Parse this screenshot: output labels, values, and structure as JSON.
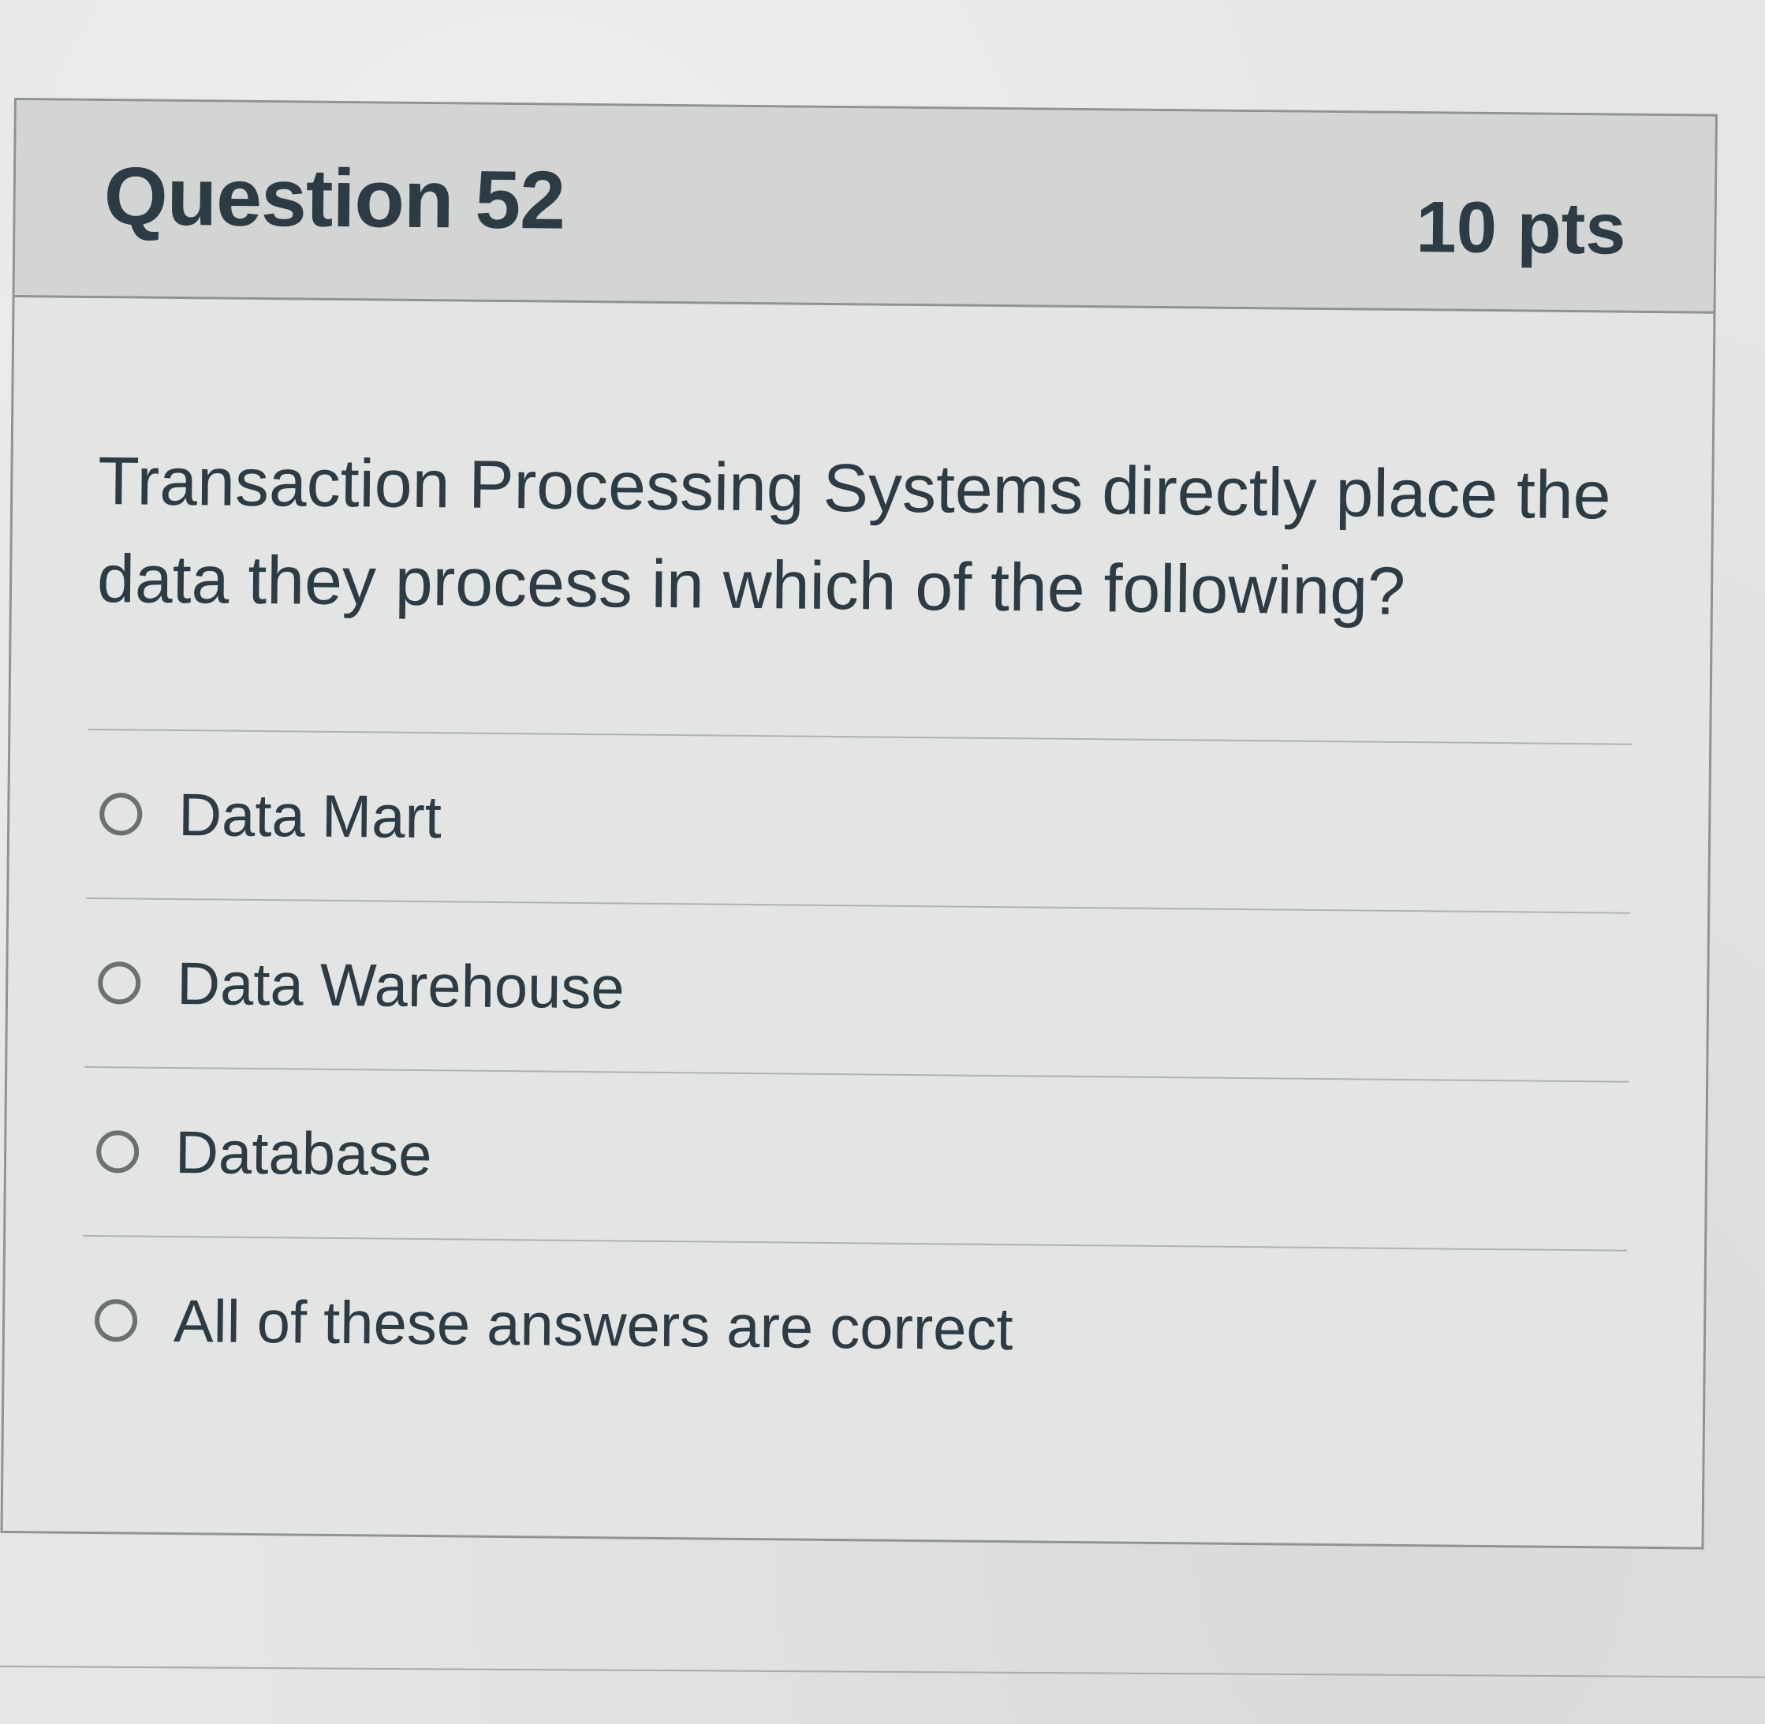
{
  "question": {
    "title": "Question 52",
    "points": "10 pts",
    "text": "Transaction Processing Systems directly place the data they process in which of the following?"
  },
  "answers": [
    {
      "label": "Data Mart",
      "selected": false
    },
    {
      "label": "Data Warehouse",
      "selected": false
    },
    {
      "label": "Database",
      "selected": false
    },
    {
      "label": "All of these answers are correct",
      "selected": false
    }
  ]
}
